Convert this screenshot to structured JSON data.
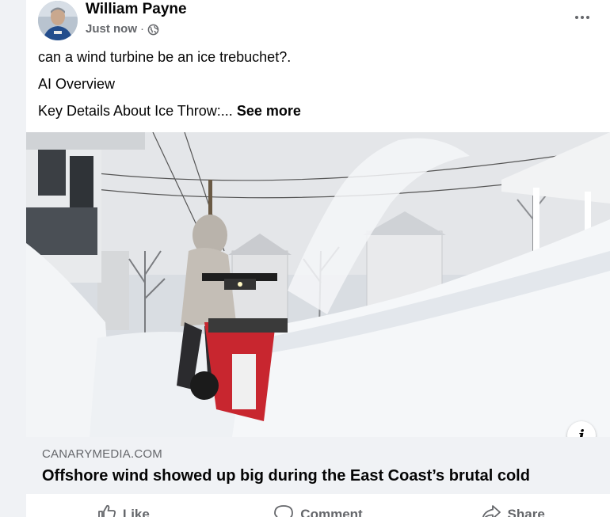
{
  "post": {
    "author": "William Payne",
    "timestamp": "Just now",
    "separator": "·",
    "audience_icon": "globe-icon",
    "text_lines": [
      "can a wind turbine be an ice trebuchet?.",
      "AI Overview",
      "Key Details About Ice Throw:..."
    ],
    "see_more": "See more"
  },
  "link_preview": {
    "domain": "CANARYMEDIA.COM",
    "headline": "Offshore wind showed up big during the East Coast’s brutal cold",
    "info_label": "i"
  },
  "actions": [
    {
      "label": "Like",
      "icon": "thumbs-up-icon"
    },
    {
      "label": "Comment",
      "icon": "comment-icon"
    },
    {
      "label": "Share",
      "icon": "share-icon"
    }
  ],
  "colors": {
    "background": "#f0f2f5",
    "card": "#ffffff",
    "secondary_text": "#65676b",
    "primary_text": "#050505"
  }
}
